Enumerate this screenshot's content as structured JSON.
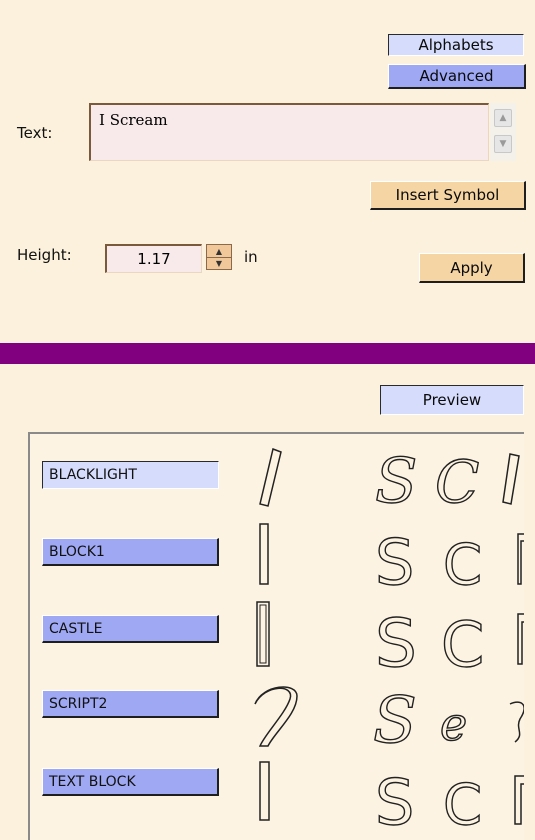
{
  "tabs": {
    "alphabets": "Alphabets",
    "advanced": "Advanced"
  },
  "text_field": {
    "label": "Text:",
    "value": "I Scream"
  },
  "insert_symbol": "Insert Symbol",
  "height": {
    "label": "Height:",
    "value": "1.17",
    "unit": "in"
  },
  "apply": "Apply",
  "preview": "Preview",
  "fonts": [
    {
      "name": "BLACKLIGHT",
      "selected": true
    },
    {
      "name": "BLOCK1",
      "selected": false
    },
    {
      "name": "CASTLE",
      "selected": false
    },
    {
      "name": "SCRIPT2",
      "selected": false
    },
    {
      "name": "TEXT BLOCK",
      "selected": false
    }
  ],
  "colors": {
    "panel": "#fcf1dc",
    "divider": "#800080",
    "selected": "#d6dcfb",
    "font_button": "#9fa8f2",
    "action_button": "#f6d5a5"
  }
}
